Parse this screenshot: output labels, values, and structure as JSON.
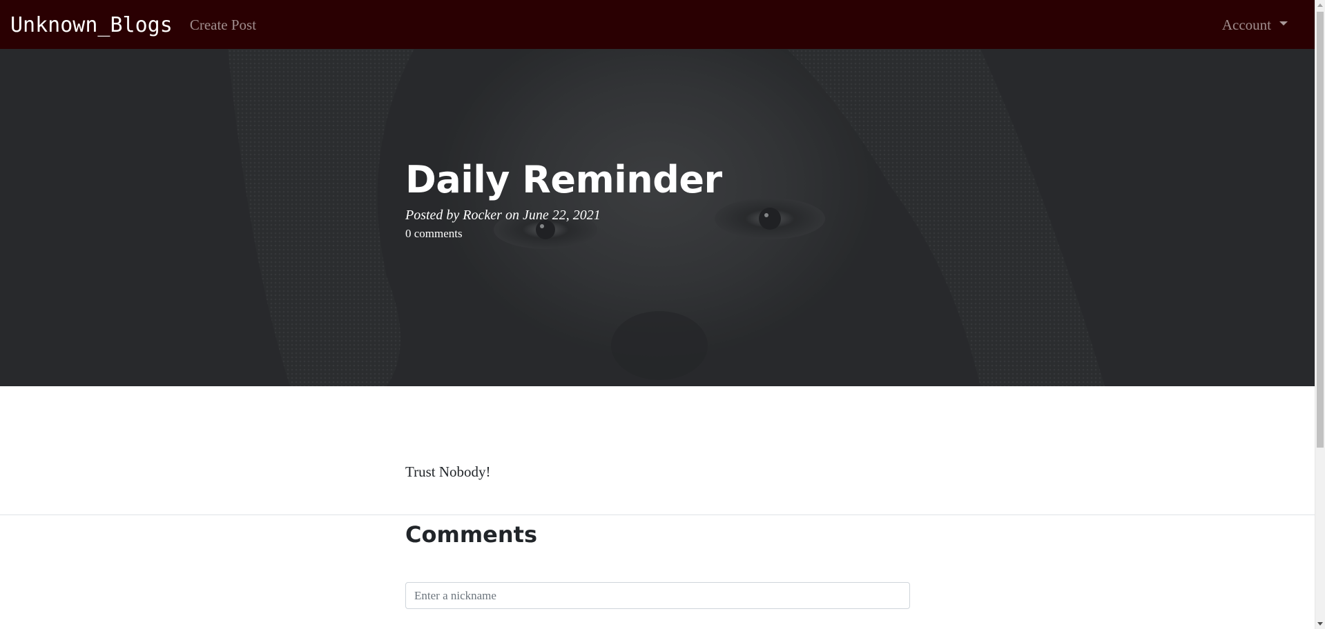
{
  "navbar": {
    "brand": "Unknown_Blogs",
    "create_post": "Create Post",
    "account": "Account",
    "background_color": "#2a0002"
  },
  "post": {
    "title": "Daily Reminder",
    "meta": "Posted by Rocker on June 22, 2021",
    "comments_count": "0 comments",
    "body": "Trust Nobody!"
  },
  "comments": {
    "heading": "Comments",
    "nickname_placeholder": "Enter a nickname",
    "nickname_value": ""
  },
  "icons": {
    "account_dropdown": "chevron-down-icon"
  }
}
